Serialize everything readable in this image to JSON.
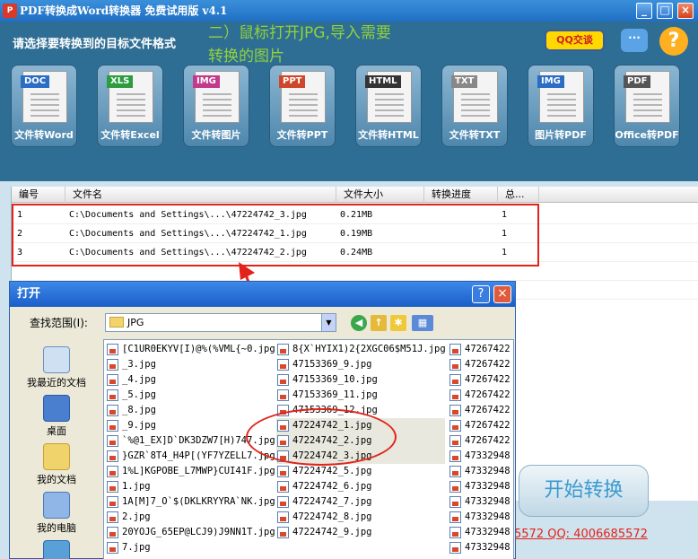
{
  "window": {
    "title": "PDF转换成Word转换器 免费试用版 v4.1",
    "min_btn": "_",
    "max_btn": "□",
    "close_btn": "×"
  },
  "header": {
    "label": "请选择要转换到的目标文件格式",
    "tip_line1": "二）鼠标打开JPG,导入需要",
    "tip_line2": "转换的图片",
    "qq_button": "QQ交谈",
    "help_icon": "?"
  },
  "tools": [
    {
      "tag": "DOC",
      "label": "文件转Word",
      "tag_color": "#2b6cc4"
    },
    {
      "tag": "XLS",
      "label": "文件转Excel",
      "tag_color": "#2c9c3e"
    },
    {
      "tag": "IMG",
      "label": "文件转图片",
      "tag_color": "#c23a8c"
    },
    {
      "tag": "PPT",
      "label": "文件转PPT",
      "tag_color": "#d0462a"
    },
    {
      "tag": "HTML",
      "label": "文件转HTML",
      "tag_color": "#333333"
    },
    {
      "tag": "TXT",
      "label": "文件转TXT",
      "tag_color": "#888888"
    },
    {
      "tag": "IMG",
      "label": "图片转PDF",
      "tag_color": "#2b6cc4"
    },
    {
      "tag": "PDF",
      "label": "Office转PDF",
      "tag_color": "#555555"
    }
  ],
  "table": {
    "headers": [
      "编号",
      "文件名",
      "文件大小",
      "转换进度",
      "总..."
    ],
    "rows": [
      {
        "no": "1",
        "name": "C:\\Documents and Settings\\...\\47224742_3.jpg",
        "size": "0.21MB",
        "progress": "",
        "total": "1"
      },
      {
        "no": "2",
        "name": "C:\\Documents and Settings\\...\\47224742_1.jpg",
        "size": "0.19MB",
        "progress": "",
        "total": "1"
      },
      {
        "no": "3",
        "name": "C:\\Documents and Settings\\...\\47224742_2.jpg",
        "size": "0.24MB",
        "progress": "",
        "total": "1"
      }
    ]
  },
  "start_button": "开始转换",
  "footer_text": "5572 QQ: 4006685572",
  "dialog": {
    "title": "打开",
    "help": "?",
    "close": "×",
    "lookin_label": "查找范围(I):",
    "lookin_value": "JPG",
    "places": [
      "我最近的文档",
      "桌面",
      "我的文档",
      "我的电脑"
    ],
    "col1": [
      "[C1UR0EKYV[I)@%(%VML{~0.jpg",
      "_3.jpg",
      "_4.jpg",
      "_5.jpg",
      "_8.jpg",
      "_9.jpg",
      "`%@1_EX]D`DK3DZW7[H)747.jpg",
      "}GZR`8T4_H4P[(YF7YZELL7.jpg",
      "1%L]KGPOBE_L7MWP}CUI41F.jpg",
      "1.jpg",
      "1A[M]7_O`$(DKLKRYYRA`NK.jpg",
      "2.jpg",
      "20YOJG_65EP@LCJ9)J9NN1T.jpg",
      "7.jpg"
    ],
    "col2": [
      "8{X`HYIX1)2{2XGC06$M51J.jpg",
      "47153369_9.jpg",
      "47153369_10.jpg",
      "47153369_11.jpg",
      "47153369_12.jpg",
      "47224742_1.jpg",
      "47224742_2.jpg",
      "47224742_3.jpg",
      "47224742_5.jpg",
      "47224742_6.jpg",
      "47224742_7.jpg",
      "47224742_8.jpg",
      "47224742_9.jpg"
    ],
    "col3": [
      "47267422",
      "47267422",
      "47267422",
      "47267422",
      "47267422",
      "47267422",
      "47267422",
      "47332948",
      "47332948",
      "47332948",
      "47332948",
      "47332948",
      "47332948",
      "47332948"
    ]
  }
}
